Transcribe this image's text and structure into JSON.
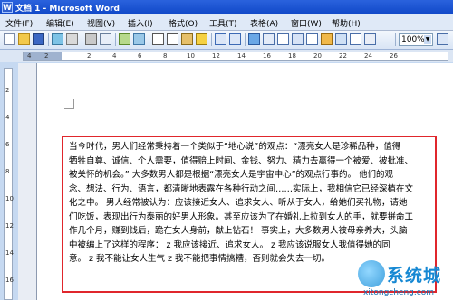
{
  "window": {
    "title": "文档 1 - Microsoft Word"
  },
  "menu": {
    "items": [
      {
        "label": "文件(F)"
      },
      {
        "label": "编辑(E)"
      },
      {
        "label": "视图(V)"
      },
      {
        "label": "插入(I)"
      },
      {
        "label": "格式(O)"
      },
      {
        "label": "工具(T)"
      },
      {
        "label": "表格(A)"
      },
      {
        "label": "窗口(W)"
      },
      {
        "label": "帮助(H)"
      }
    ]
  },
  "toolbar": {
    "zoom": "100%"
  },
  "ruler": {
    "numbers": [
      "4",
      "2",
      "2",
      "4",
      "6",
      "8",
      "10",
      "12",
      "14",
      "16",
      "18",
      "20",
      "22",
      "24",
      "26"
    ]
  },
  "vruler": {
    "numbers": [
      "2",
      "4",
      "6",
      "8",
      "10",
      "12",
      "14",
      "16"
    ]
  },
  "document": {
    "lines": [
      "当今时代，男人们经常秉持着一个类似于“地心说”的观点：“漂亮女人是珍稀品种，值得",
      "牺牲自尊、诚信、个人需要，值得赔上时间、金钱、努力、精力去赢得一个被爱、被批准、",
      "被关怀的机会。”   大多数男人都是根据“漂亮女人是宇宙中心”的观点行事的。 他们的观",
      "念、想法、行为、语言，都清晰地表露在各种行动之间……实际上，我相信它已经深植在文",
      "化之中。 男人经常被认为：应该接近女人、追求女人、听从于女人，给她们买礼物，请她",
      "们吃饭，表现出行为泰丽的好男人形象。甚至应该为了在婚礼上拉到女人的手，就要拼命工",
      "作几个月，赚到钱后，跪在女人身前，献上钻石！   事实上，大多数男人被母亲养大，头脑",
      "中被编上了这样的程序：  z   我应该接近、追求女人。  z   我应该说服女人我值得她的同",
      "意。  z   我不能让女人生气  z   我不能把事情搞糟，否则就会失去一切。"
    ]
  },
  "watermark": {
    "brand": "系统城",
    "url": "xitongcheng.com"
  }
}
